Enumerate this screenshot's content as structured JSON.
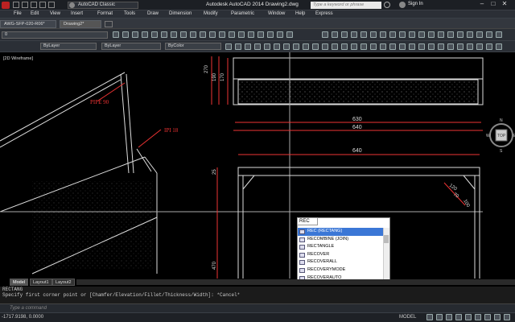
{
  "titlebar": {
    "workspace": "AutoCAD Classic",
    "title": "Autodesk AutoCAD 2014    Drawing2.dwg",
    "search_placeholder": "Type a keyword or phrase",
    "signin": "Sign In"
  },
  "menu": [
    "File",
    "Edit",
    "View",
    "Insert",
    "Format",
    "Tools",
    "Draw",
    "Dimension",
    "Modify",
    "Parametric",
    "Window",
    "Help",
    "Express"
  ],
  "file_tabs": [
    "AWG-SFP-020-R06*",
    "Drawing2*"
  ],
  "toolbar": {
    "layer_value": "0",
    "linetype1": "ByLayer",
    "linetype2": "ByLayer",
    "color": "ByColor"
  },
  "viewport_label": "[2D Wireframe]",
  "drawing_labels": {
    "pipe": "PIPE 90",
    "ipi": "IPI 18",
    "dims": [
      "630",
      "640",
      "640",
      "270",
      "190",
      "170",
      "25",
      "470",
      "120",
      "70",
      "100"
    ]
  },
  "compass": {
    "n": "N",
    "s": "S",
    "e": "E",
    "w": "W",
    "top": "TOP"
  },
  "command_popup": {
    "input": "REC",
    "items": [
      "REC (RECTANG)",
      "RECOMBINE (JOIN)",
      "RECTANGLE",
      "RECOVER",
      "RECOVERALL",
      "RECOVERYMODE",
      "RECOVERAUTO"
    ],
    "selected_index": 0
  },
  "layout_tabs": [
    "Model",
    "Layout1",
    "Layout2"
  ],
  "command_history": [
    "RECTANG",
    "Specify first corner point or [Chamfer/Elevation/Fillet/Thickness/Width]: *Cancel*"
  ],
  "command_placeholder": "Type a command",
  "status": {
    "coords": "-1717.9198, 0.0000",
    "model": "MODEL"
  }
}
